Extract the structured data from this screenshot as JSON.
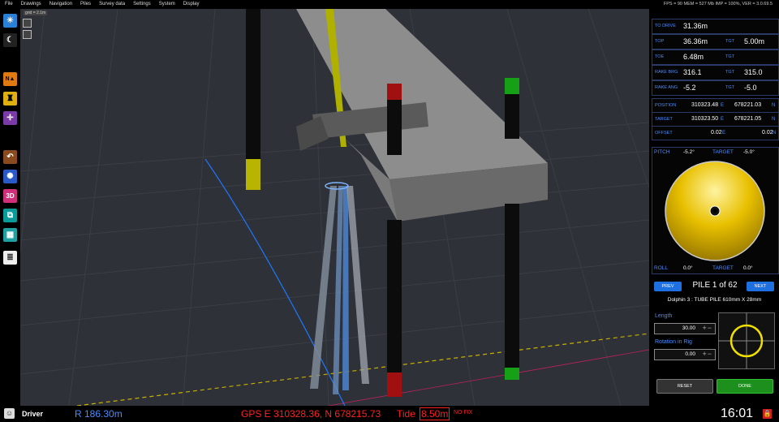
{
  "menu": [
    "File",
    "Drawings",
    "Navigation",
    "Piles",
    "Survey data",
    "Settings",
    "System",
    "Display"
  ],
  "status_line": "FPS = 90 MEM = 527 Mb IMP = 100%, VER = 3.0.69.5",
  "viewport": {
    "grid_label": "grid = 2.1m"
  },
  "toolbar": {
    "icons": [
      "sun-icon",
      "moon-icon",
      "north-arrow-icon",
      "rig-icon",
      "crosshair-icon",
      "undo-icon",
      "settings-wheel-icon",
      "3d-icon",
      "layers-icon",
      "table-icon",
      "notepad-icon"
    ],
    "label_3d": "3D"
  },
  "panel": {
    "to_drive": {
      "label": "TO DRIVE",
      "value": "31.36m"
    },
    "top": {
      "label": "TOP",
      "value": "36.36m",
      "tgt_label": "TGT",
      "tgt_value": "5.00m"
    },
    "toe": {
      "label": "TOE",
      "value": "6.48m",
      "tgt_label": "TGT",
      "tgt_value": ""
    },
    "rake_brg": {
      "label": "RAKE BRG",
      "value": "316.1",
      "tgt_label": "TGT",
      "tgt_value": "315.0"
    },
    "rake_ang": {
      "label": "RAKE ANG",
      "value": "-5.2",
      "tgt_label": "TGT",
      "tgt_value": "-5.0"
    },
    "position": {
      "label": "POSITION",
      "e": "310323.48",
      "n": "678221.03"
    },
    "target": {
      "label": "TARGET",
      "e": "310323.50",
      "n": "678221.05"
    },
    "offset": {
      "label": "OFFSET",
      "e": "0.02",
      "n": "0.02"
    },
    "e_unit": "E",
    "n_unit": "N",
    "pitch": {
      "label": "PITCH",
      "value": "-5.2°",
      "tgt_label": "TARGET",
      "tgt_value": "-5.0°"
    },
    "roll": {
      "label": "ROLL",
      "value": "0.0°",
      "tgt_label": "TARGET",
      "tgt_value": "0.0°"
    },
    "prev": "PREV",
    "next": "NEXT",
    "pile_title": "PILE 1 of 62",
    "pile_desc": "Dolphin 3 : TUBE PILE 610mm X 28mm",
    "length": {
      "label": "Length",
      "value": "30.00"
    },
    "rotation": {
      "label": "Rotation in Rig",
      "value": "0.00"
    },
    "reset": "RESET",
    "done": "DONE"
  },
  "bottom": {
    "role": "Driver",
    "range": "R 186.30m",
    "gps": "GPS  E 310328.36, N 678215.73",
    "tide_label": "Tide",
    "tide_value": "8.50m",
    "fix": "NO FIX",
    "time": "16:01"
  },
  "colors": {
    "accent": "#1e6fe0",
    "label_blue": "#4a8cff",
    "gps_red": "#ff2020",
    "done_green": "#1d8f1d",
    "yellow": "#d8b800"
  }
}
